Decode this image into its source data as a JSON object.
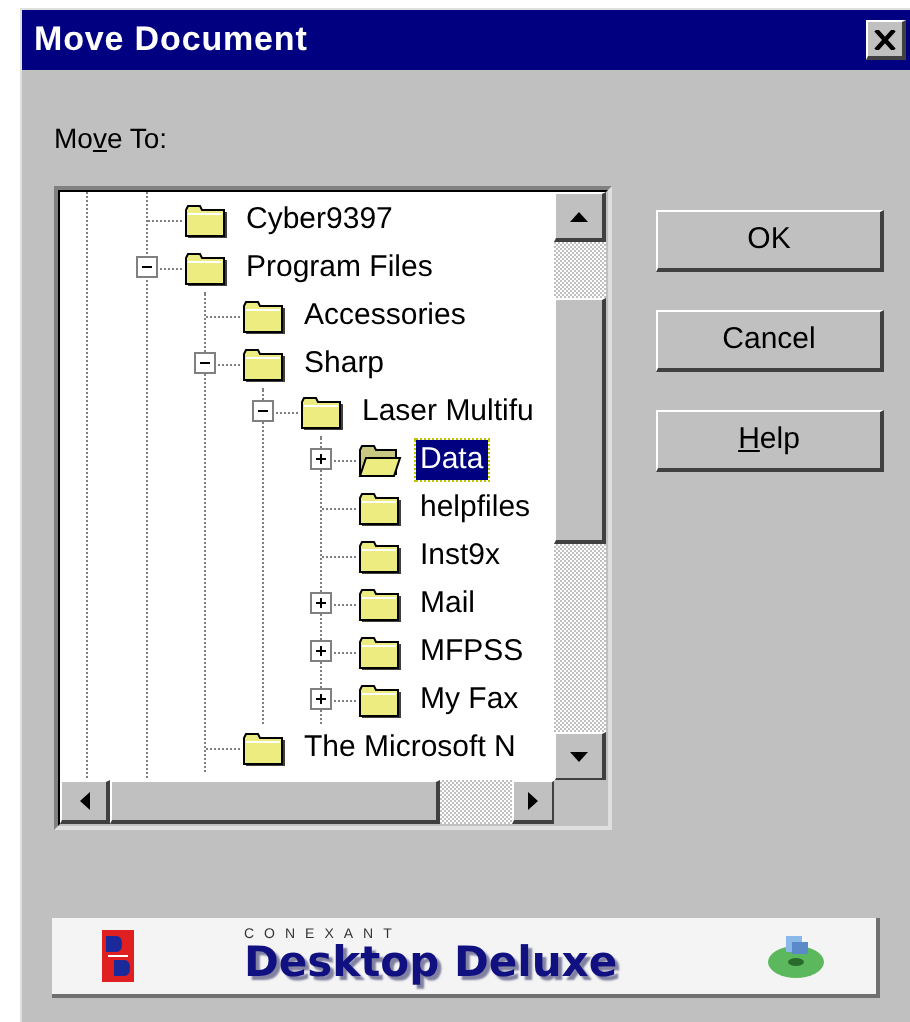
{
  "window": {
    "title": "Move Document"
  },
  "move_to_label": {
    "before": "Mo",
    "key": "v",
    "after": "e To:"
  },
  "tree": [
    {
      "label": "Cyber9397",
      "has_children": false,
      "selected": false
    },
    {
      "label": "Program Files",
      "has_children": true,
      "expanded": true,
      "selected": false,
      "children": [
        {
          "label": "Accessories",
          "has_children": false,
          "selected": false
        },
        {
          "label": "Sharp",
          "has_children": true,
          "expanded": true,
          "selected": false,
          "children": [
            {
              "label": "Laser Multifu",
              "has_children": true,
              "expanded": true,
              "selected": false,
              "children": [
                {
                  "label": "Data",
                  "has_children": true,
                  "expanded": false,
                  "selected": true
                },
                {
                  "label": "helpfiles",
                  "has_children": false,
                  "selected": false
                },
                {
                  "label": "Inst9x",
                  "has_children": false,
                  "selected": false
                },
                {
                  "label": "Mail",
                  "has_children": true,
                  "expanded": false,
                  "selected": false
                },
                {
                  "label": "MFPSS",
                  "has_children": true,
                  "expanded": false,
                  "selected": false
                },
                {
                  "label": "My Fax",
                  "has_children": true,
                  "expanded": false,
                  "selected": false
                }
              ]
            }
          ]
        },
        {
          "label": "The Microsoft N",
          "has_children": false,
          "selected": false
        }
      ]
    }
  ],
  "buttons": [
    {
      "after": "OK"
    },
    {
      "after": "Cancel"
    },
    {
      "key": "H",
      "after": "elp"
    }
  ],
  "banner": {
    "brand": "CONEXANT",
    "product": "Desktop Deluxe"
  }
}
